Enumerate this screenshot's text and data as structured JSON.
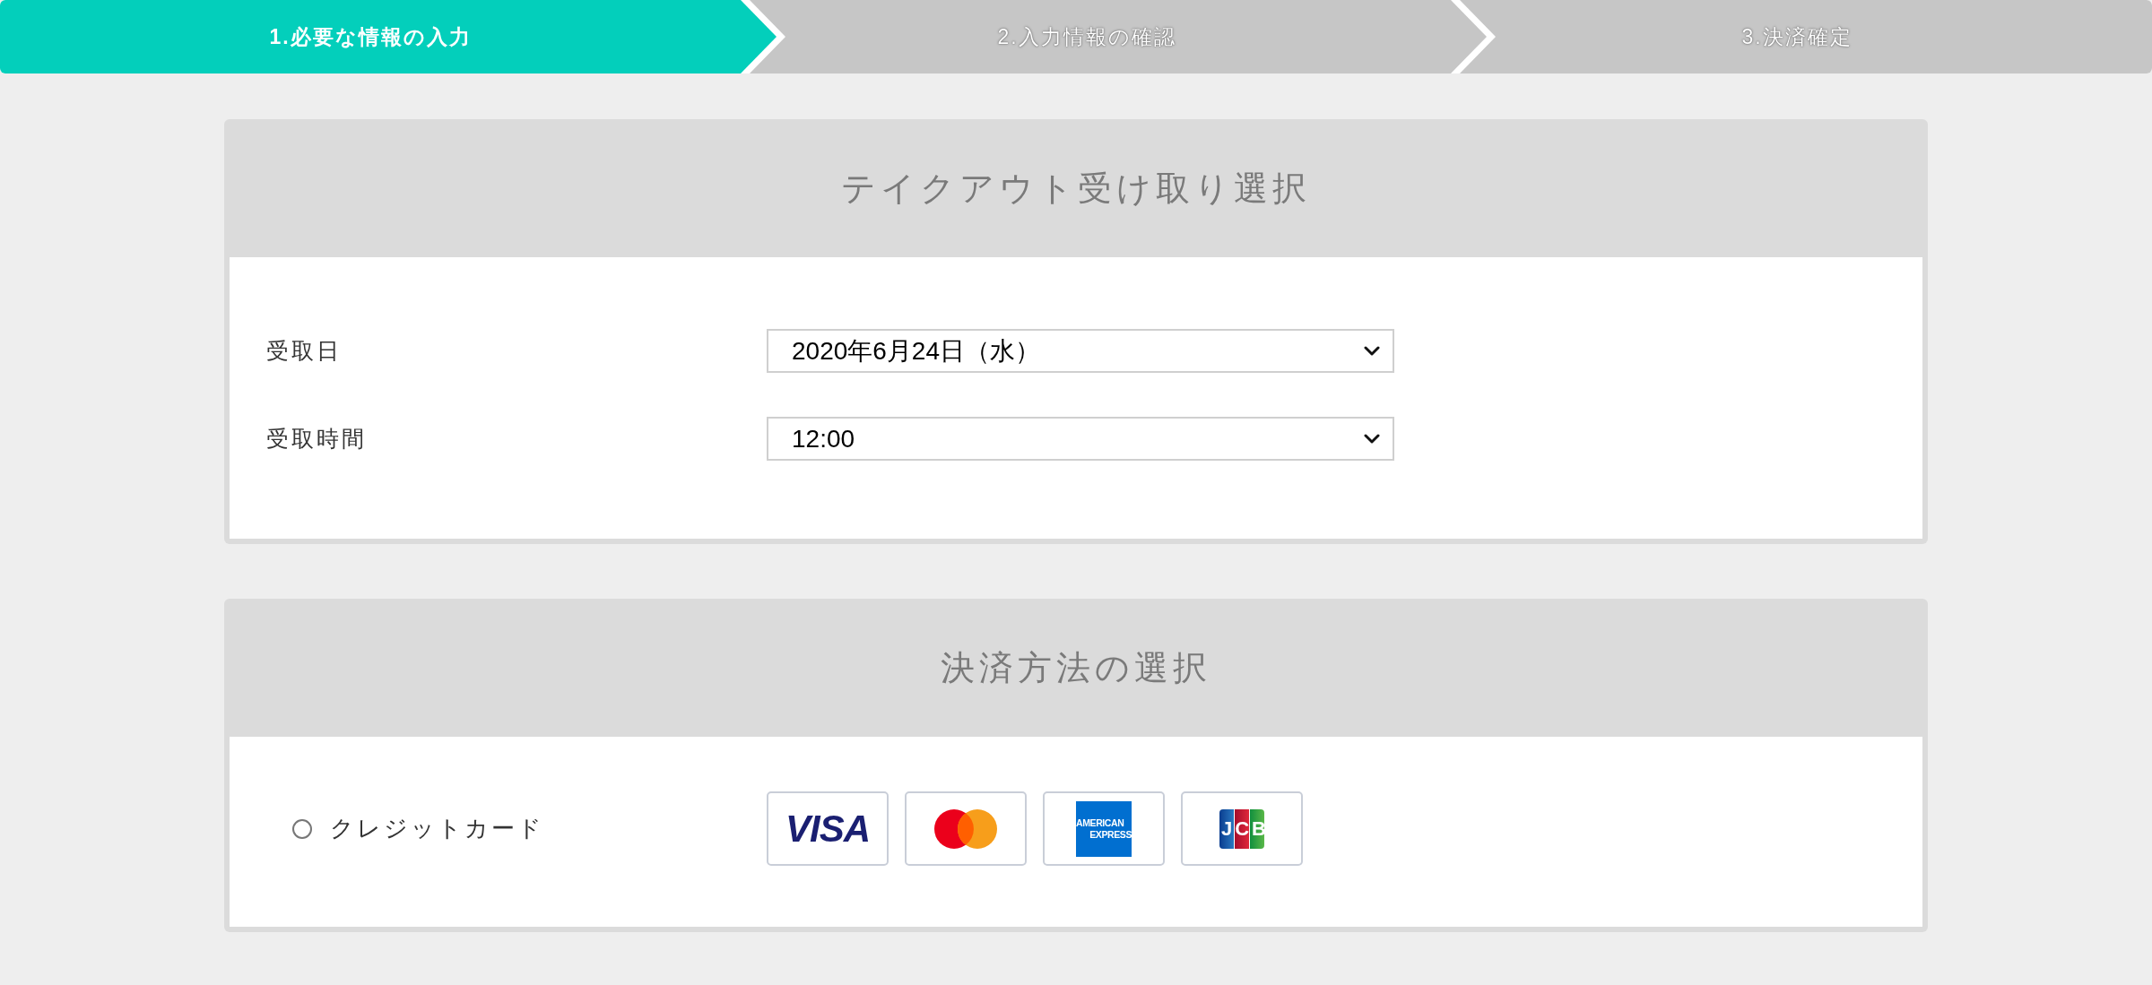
{
  "steps": [
    {
      "label": "1.必要な情報の入力",
      "selected": true
    },
    {
      "label": "2.入力情報の確認",
      "selected": false
    },
    {
      "label": "3.決済確定",
      "selected": false
    }
  ],
  "pickup": {
    "title": "テイクアウト受け取り選択",
    "fields": [
      {
        "label": "受取日",
        "value": "2020年6月24日（水）"
      },
      {
        "label": "受取時間",
        "value": "12:00"
      }
    ]
  },
  "payment": {
    "title": "決済方法の選択",
    "methods": [
      {
        "label": "クレジットカード",
        "selected": false,
        "logos": [
          {
            "kind": "visa",
            "text": "VISA"
          },
          {
            "kind": "mastercard"
          },
          {
            "kind": "amex",
            "lines": [
              "AMERICAN",
              "EXPRESS"
            ]
          },
          {
            "kind": "jcb",
            "text": "JCB"
          }
        ]
      }
    ]
  }
}
